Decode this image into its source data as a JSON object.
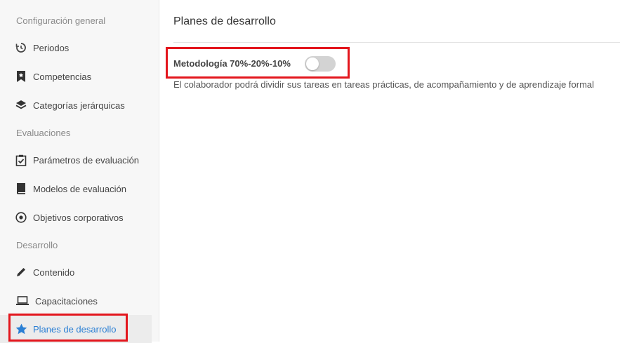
{
  "sidebar": {
    "sections": [
      {
        "label": "Configuración general"
      },
      {
        "label": "Evaluaciones"
      },
      {
        "label": "Desarrollo"
      }
    ],
    "items": [
      {
        "label": "Periodos",
        "icon": "history-icon"
      },
      {
        "label": "Competencias",
        "icon": "bookmark-star-icon"
      },
      {
        "label": "Categorías jerárquicas",
        "icon": "layers-icon"
      },
      {
        "label": "Parámetros de evaluación",
        "icon": "clipboard-check-icon"
      },
      {
        "label": "Modelos de evaluación",
        "icon": "book-icon"
      },
      {
        "label": "Objetivos corporativos",
        "icon": "target-icon"
      },
      {
        "label": "Contenido",
        "icon": "pencil-icon"
      },
      {
        "label": "Capacitaciones",
        "icon": "laptop-icon"
      },
      {
        "label": "Planes de desarrollo",
        "icon": "star-icon",
        "active": true
      }
    ]
  },
  "main": {
    "title": "Planes de desarrollo",
    "setting": {
      "label": "Metodología 70%-20%-10%",
      "enabled": false,
      "description": "El colaborador podrá dividir sus tareas en tareas prácticas, de acompañamiento y de aprendizaje formal"
    }
  },
  "colors": {
    "accent": "#2a7fd4",
    "highlight": "#e3161d",
    "toggle_off": "#d3d3d3"
  }
}
